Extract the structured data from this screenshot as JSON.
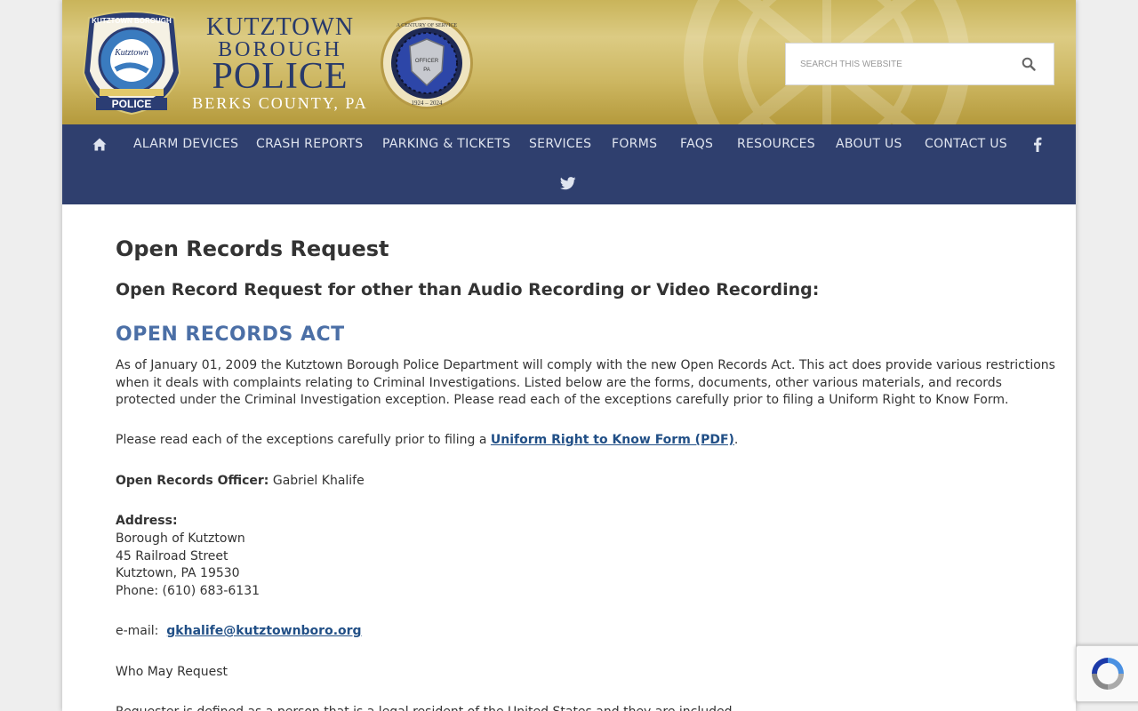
{
  "header": {
    "logo_text": "KUTZTOWN BOROUGH POLICE",
    "title_line1": "KUTZTOWN",
    "title_line2": "BOROUGH",
    "title_line3": "POLICE",
    "title_line4": "BERKS COUNTY, PA",
    "seal_text": "A CENTURY OF SERVICE 1924 – 2024",
    "search_placeholder": "SEARCH THIS WEBSITE"
  },
  "nav": {
    "items": [
      {
        "label": "ALARM DEVICES"
      },
      {
        "label": "CRASH REPORTS"
      },
      {
        "label": "PARKING & TICKETS"
      },
      {
        "label": "SERVICES"
      },
      {
        "label": "FORMS"
      },
      {
        "label": "FAQS"
      },
      {
        "label": "RESOURCES"
      },
      {
        "label": "ABOUT US"
      },
      {
        "label": "CONTACT US"
      }
    ],
    "icons": [
      "home-icon",
      "facebook-icon",
      "twitter-icon"
    ]
  },
  "content": {
    "page_title": "Open Records Request",
    "sub_title": "Open Record Request for other than Audio Recording or Video Recording:",
    "act_heading": "OPEN RECORDS ACT",
    "intro_lines": [
      "As of January 01, 2009 the Kutztown Borough Police Department will comply with the new Open Records Act. This act does provide various restrictions",
      "when it deals with complaints relating to Criminal Investigations.  Listed below are the forms, documents, other various materials, and records",
      "protected under the Criminal Investigation exception. Please read each of the exceptions carefully prior to filing a Uniform Right to Know Form."
    ],
    "please_read_prefix": "Please read each of the exceptions carefully prior to filing a ",
    "please_read_link": "Uniform Right to Know Form (PDF)",
    "please_read_suffix": ".",
    "officer_label": "Open Records Officer:",
    "officer_name": " Gabriel Khalife",
    "address_label": "Address:",
    "address_lines": [
      "Borough of Kutztown",
      "45 Railroad Street",
      "Kutztown, PA 19530",
      "Phone: (610) 683-6131"
    ],
    "email_label": "e-mail:  ",
    "email": "gkhalife@kutztownboro.org",
    "who_may_request": "Who May Request",
    "cut_off_line": "Requester is defined as a person that is a legal resident of the United States and they are included..."
  },
  "colors": {
    "nav_bg": "#2f3f6e",
    "header_gold": "#cdb762",
    "title_blue": "#283a6b",
    "heading_blue": "#4b6fa6",
    "link_blue": "#214f86"
  }
}
